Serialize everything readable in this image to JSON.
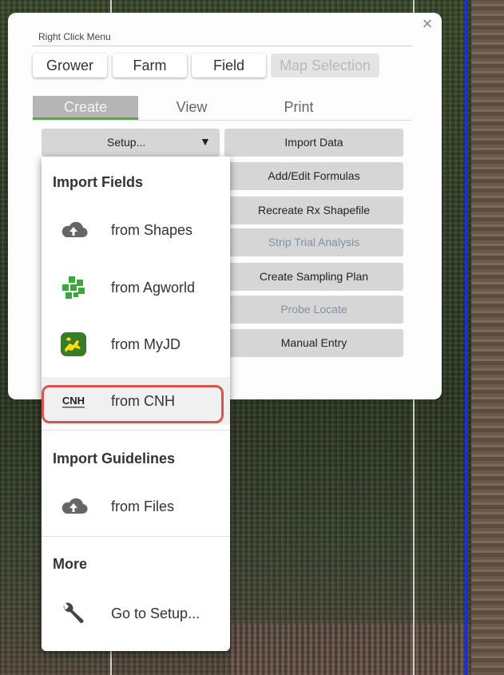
{
  "panel": {
    "title": "Right Click Menu",
    "close_icon": "×"
  },
  "levels": [
    {
      "label": "Grower",
      "enabled": true
    },
    {
      "label": "Farm",
      "enabled": true
    },
    {
      "label": "Field",
      "enabled": true
    },
    {
      "label": "Map Selection",
      "enabled": false
    }
  ],
  "tabs": [
    {
      "label": "Create",
      "active": true
    },
    {
      "label": "View",
      "active": false
    },
    {
      "label": "Print",
      "active": false
    }
  ],
  "setup": {
    "label": "Setup...",
    "caret": "▼"
  },
  "actions": [
    {
      "label": "Import Data",
      "muted": false
    },
    {
      "label": "Add/Edit Formulas",
      "muted": false
    },
    {
      "label": "Recreate Rx Shapefile",
      "muted": false
    },
    {
      "label": "Strip Trial Analysis",
      "muted": true
    },
    {
      "label": "Create Sampling Plan",
      "muted": false
    },
    {
      "label": "Probe Locate",
      "muted": true
    },
    {
      "label": "Manual Entry",
      "muted": false
    }
  ],
  "dropdown": {
    "sections": {
      "import_fields": "Import Fields",
      "import_guidelines": "Import Guidelines",
      "more": "More"
    },
    "items": {
      "shapes": {
        "label": "from Shapes",
        "icon": "cloud-upload-icon"
      },
      "agworld": {
        "label": "from Agworld",
        "icon": "agworld-logo-icon"
      },
      "myjd": {
        "label": "from MyJD",
        "icon": "john-deere-logo-icon"
      },
      "cnh": {
        "label": "from CNH",
        "icon": "cnh-logo-icon",
        "logo_text": "CNH",
        "highlighted": true
      },
      "files": {
        "label": "from Files",
        "icon": "cloud-upload-icon"
      },
      "setup": {
        "label": "Go to Setup...",
        "icon": "wrench-icon"
      }
    }
  },
  "colors": {
    "tab_active_underline": "#4caf3c",
    "highlight_border": "#d9534f",
    "map_boundary": "#1830d8",
    "agworld_green": "#3aa935",
    "john_deere_green": "#367c2b",
    "john_deere_yellow": "#ffde00"
  }
}
